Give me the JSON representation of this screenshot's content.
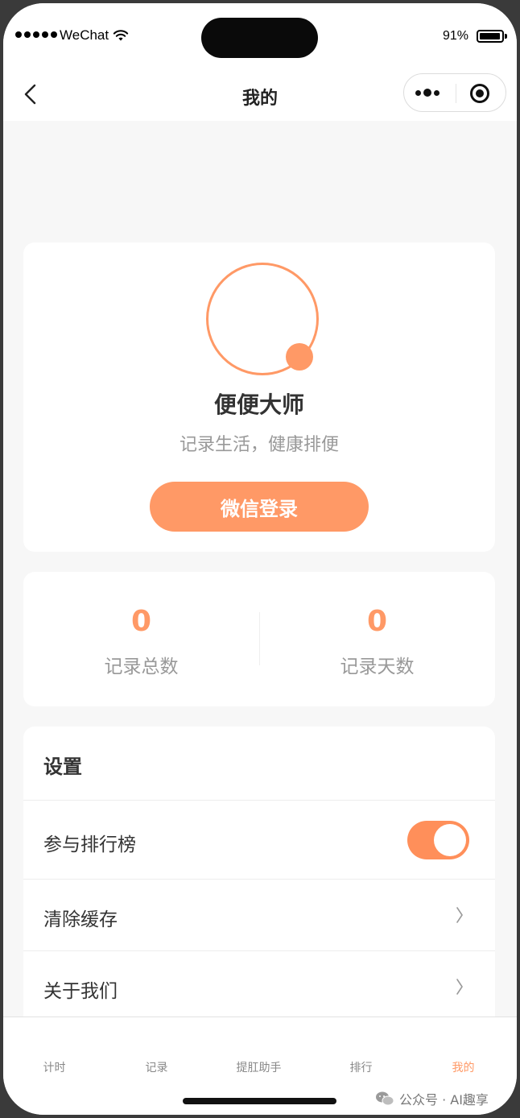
{
  "status_bar": {
    "carrier": "WeChat",
    "battery_percent": "91%",
    "signal_dots": 5,
    "battery_level": 0.91
  },
  "nav": {
    "title": "我的",
    "back_icon": "chevron-left-icon",
    "more_icon": "more-dots-icon",
    "close_icon": "target-circle-icon"
  },
  "profile": {
    "app_name": "便便大师",
    "slogan": "记录生活，健康排便",
    "login_button": "微信登录"
  },
  "stats": {
    "total": {
      "value": "0",
      "label": "记录总数"
    },
    "days": {
      "value": "0",
      "label": "记录天数"
    }
  },
  "settings": {
    "title": "设置",
    "items": [
      {
        "label": "参与排行榜",
        "control": "toggle",
        "on": true
      },
      {
        "label": "清除缓存",
        "control": "chevron",
        "chevron": "〉"
      },
      {
        "label": "关于我们",
        "control": "chevron",
        "chevron": "〉"
      }
    ]
  },
  "tabbar": {
    "tabs": [
      {
        "label": "计时",
        "active": false
      },
      {
        "label": "记录",
        "active": false
      },
      {
        "label": "提肛助手",
        "active": false
      },
      {
        "label": "排行",
        "active": false
      },
      {
        "label": "我的",
        "active": true
      }
    ]
  },
  "watermark": {
    "text": "公众号 · AI趣享",
    "icon": "wechat-icon"
  },
  "colors": {
    "accent": "#ff9966",
    "background": "#f7f7f7",
    "muted_text": "#999999"
  }
}
